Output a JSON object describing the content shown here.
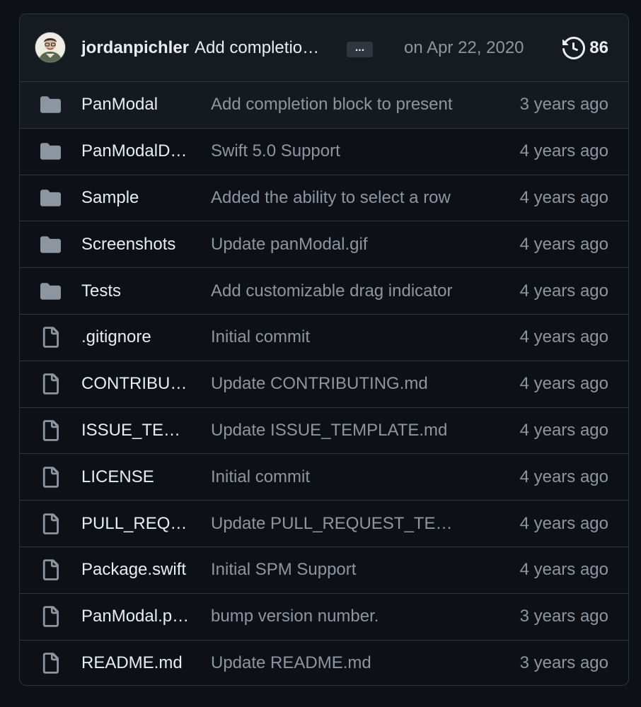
{
  "commit": {
    "author": "jordanpichler",
    "message": "Add completion block to present",
    "ellipsis_label": "...",
    "date": "on Apr 22, 2020",
    "history_count": "86"
  },
  "icons": {
    "folder": "folder-icon",
    "file": "file-icon",
    "history": "history-icon"
  },
  "colors": {
    "background": "#0d1117",
    "header_background": "#161b22",
    "border": "#30363d",
    "text_primary": "#e6edf3",
    "text_muted": "#8d96a0",
    "icon": "#8d96a0"
  },
  "files": [
    {
      "type": "folder",
      "name": "PanModal",
      "message": "Add completion block to present",
      "age": "3 years ago"
    },
    {
      "type": "folder",
      "name": "PanModalDemo",
      "message": "Swift 5.0 Support",
      "age": "4 years ago"
    },
    {
      "type": "folder",
      "name": "Sample",
      "message": "Added the ability to select a row",
      "age": "4 years ago"
    },
    {
      "type": "folder",
      "name": "Screenshots",
      "message": "Update panModal.gif",
      "age": "4 years ago"
    },
    {
      "type": "folder",
      "name": "Tests",
      "message": "Add customizable drag indicator",
      "age": "4 years ago"
    },
    {
      "type": "file",
      "name": ".gitignore",
      "message": "Initial commit",
      "age": "4 years ago"
    },
    {
      "type": "file",
      "name": "CONTRIBUTING.md",
      "message": "Update CONTRIBUTING.md",
      "age": "4 years ago"
    },
    {
      "type": "file",
      "name": "ISSUE_TEMPLATE.md",
      "message": "Update ISSUE_TEMPLATE.md",
      "age": "4 years ago"
    },
    {
      "type": "file",
      "name": "LICENSE",
      "message": "Initial commit",
      "age": "4 years ago"
    },
    {
      "type": "file",
      "name": "PULL_REQUEST_TEMPLATE.md",
      "message": "Update PULL_REQUEST_TEMPLATE.md",
      "age": "4 years ago"
    },
    {
      "type": "file",
      "name": "Package.swift",
      "message": "Initial SPM Support",
      "age": "4 years ago"
    },
    {
      "type": "file",
      "name": "PanModal.podspec",
      "message": "bump version number.",
      "age": "3 years ago"
    },
    {
      "type": "file",
      "name": "README.md",
      "message": "Update README.md",
      "age": "3 years ago"
    }
  ]
}
